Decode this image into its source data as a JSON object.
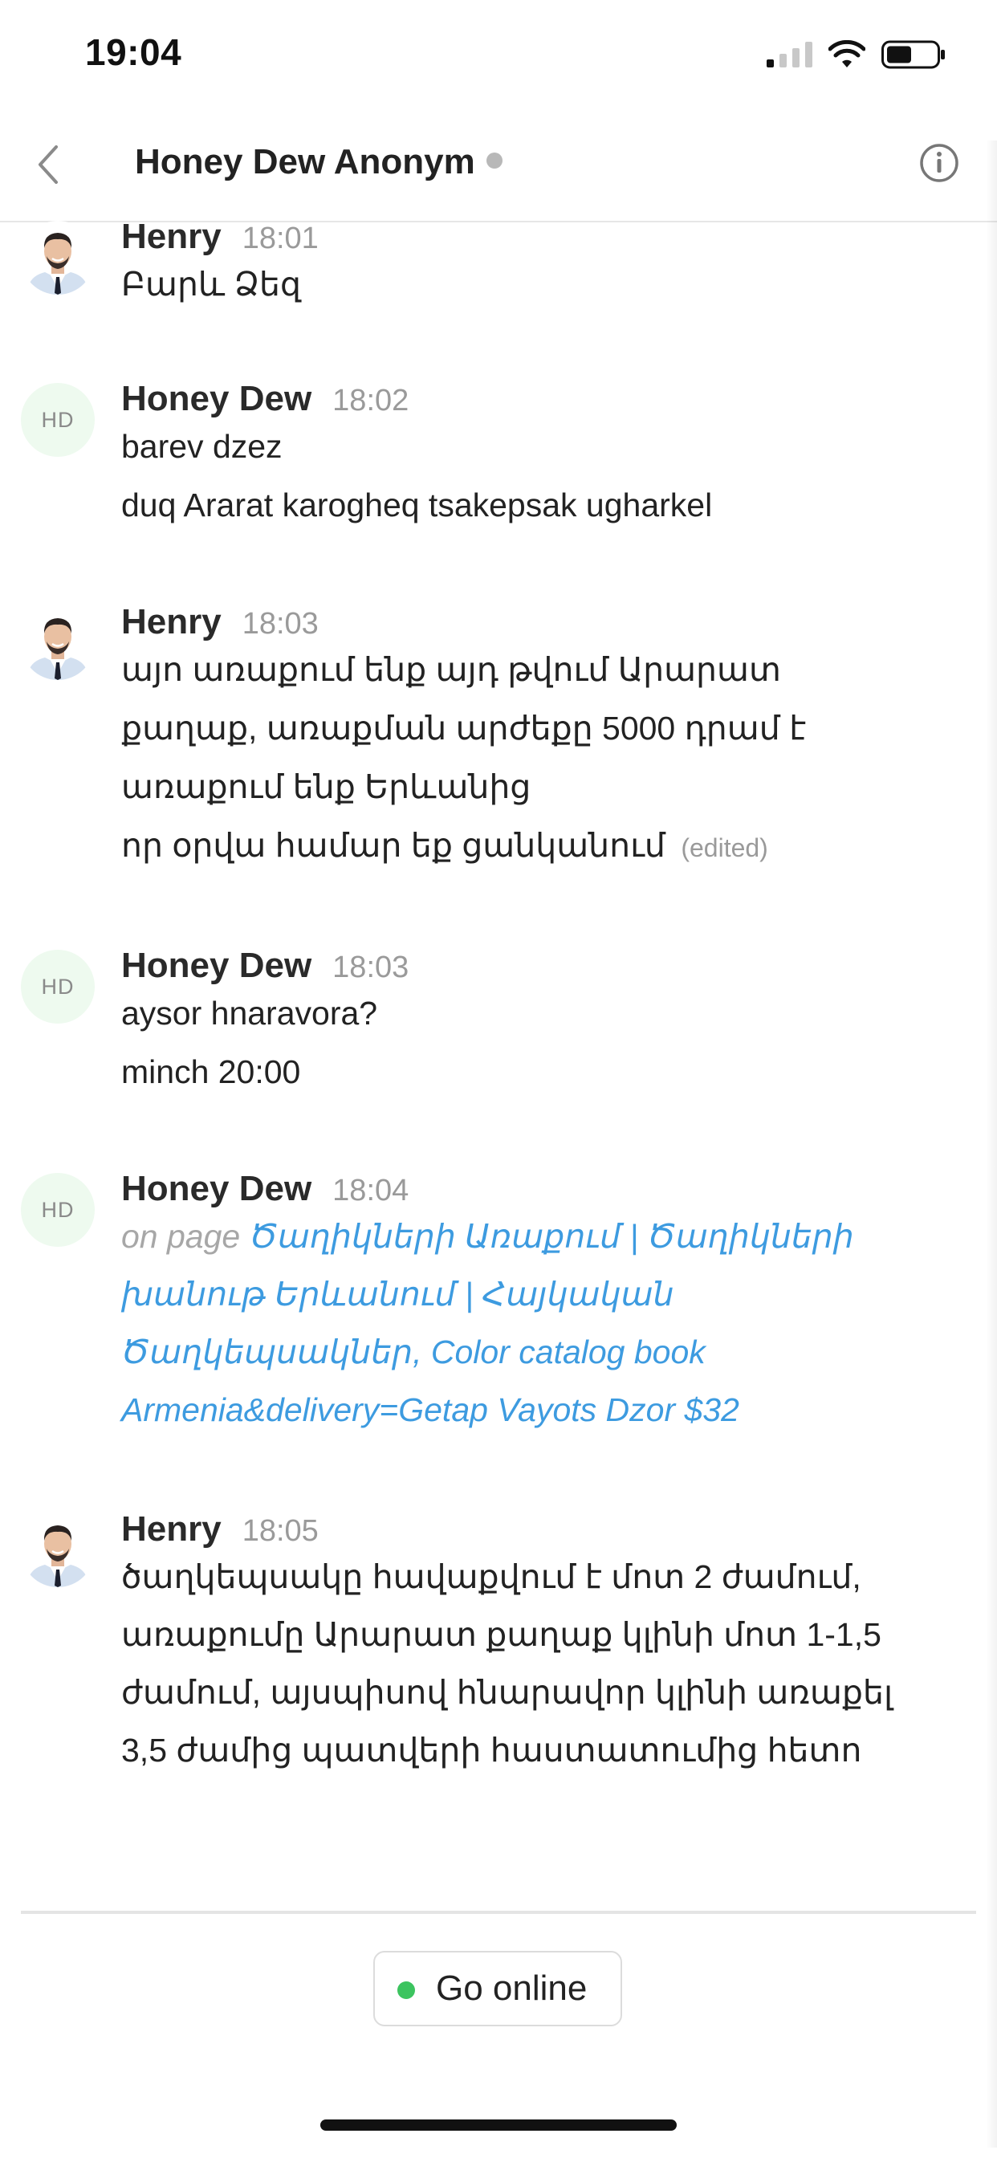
{
  "status_bar": {
    "time": "19:04"
  },
  "header": {
    "title": "Honey Dew Anonym"
  },
  "messages": [
    {
      "sender": "Henry",
      "time": "18:01",
      "lines": [
        "Բարև Ձեզ"
      ]
    },
    {
      "sender": "Honey Dew",
      "initials": "HD",
      "time": "18:02",
      "lines": [
        "barev dzez",
        "duq Ararat karogheq tsakepsak ugharkel"
      ]
    },
    {
      "sender": "Henry",
      "time": "18:03",
      "lines": [
        "այո առաքում ենք այդ թվում Արարատ",
        "քաղաք, առաքման արժեքը 5000 դրամ է",
        "առաքում ենք Երևանից",
        "որ օրվա համար եք ցանկանում"
      ],
      "edited": "(edited)"
    },
    {
      "sender": "Honey Dew",
      "initials": "HD",
      "time": "18:03",
      "lines": [
        "aysor hnaravora?",
        "minch 20:00"
      ]
    },
    {
      "sender": "Honey Dew",
      "initials": "HD",
      "time": "18:04",
      "page_prefix": "on page",
      "page_link_lines": [
        "Ծաղիկների Առաքում | Ծաղիկների",
        "խանութ Երևանում | Հայկական",
        "Ծաղկեպսակներ, Color catalog book",
        "Armenia&delivery=Getap Vayots Dzor $32"
      ]
    },
    {
      "sender": "Henry",
      "time": "18:05",
      "lines": [
        "ծաղկեպսակը հավաքվում է մոտ 2 ժամում,",
        "առաքումը Արարատ քաղաք կլինի մոտ 1-1,5",
        "ժամում, այսպիսով հնարավոր կլինի առաքել",
        "3,5 ժամից պատվերի հաստատումից հետո"
      ]
    }
  ],
  "footer": {
    "go_online_label": "Go online",
    "status_color": "#3cc45f"
  },
  "colors": {
    "link": "#3d9be0",
    "avatar_initials_bg": "#eefaef"
  },
  "icons": [
    "back-chevron-icon",
    "info-icon",
    "signal-icon",
    "wifi-icon",
    "battery-icon",
    "presence-dot-icon"
  ]
}
